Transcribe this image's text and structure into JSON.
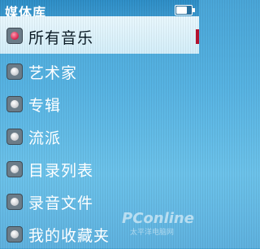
{
  "header": {
    "title": "媒体库",
    "battery_level": 0.7
  },
  "menu": {
    "items": [
      {
        "label": "所有音乐",
        "selected": true
      },
      {
        "label": "艺术家",
        "selected": false
      },
      {
        "label": "专辑",
        "selected": false
      },
      {
        "label": "流派",
        "selected": false
      },
      {
        "label": "目录列表",
        "selected": false
      },
      {
        "label": "录音文件",
        "selected": false
      },
      {
        "label": "我的收藏夹",
        "selected": false
      }
    ]
  },
  "watermark": {
    "brand": "PConline",
    "sub": "太平洋电脑网"
  },
  "colors": {
    "background": "#57b3e2",
    "selected_bg": "#e2f4fb",
    "accent": "#b3122f"
  }
}
